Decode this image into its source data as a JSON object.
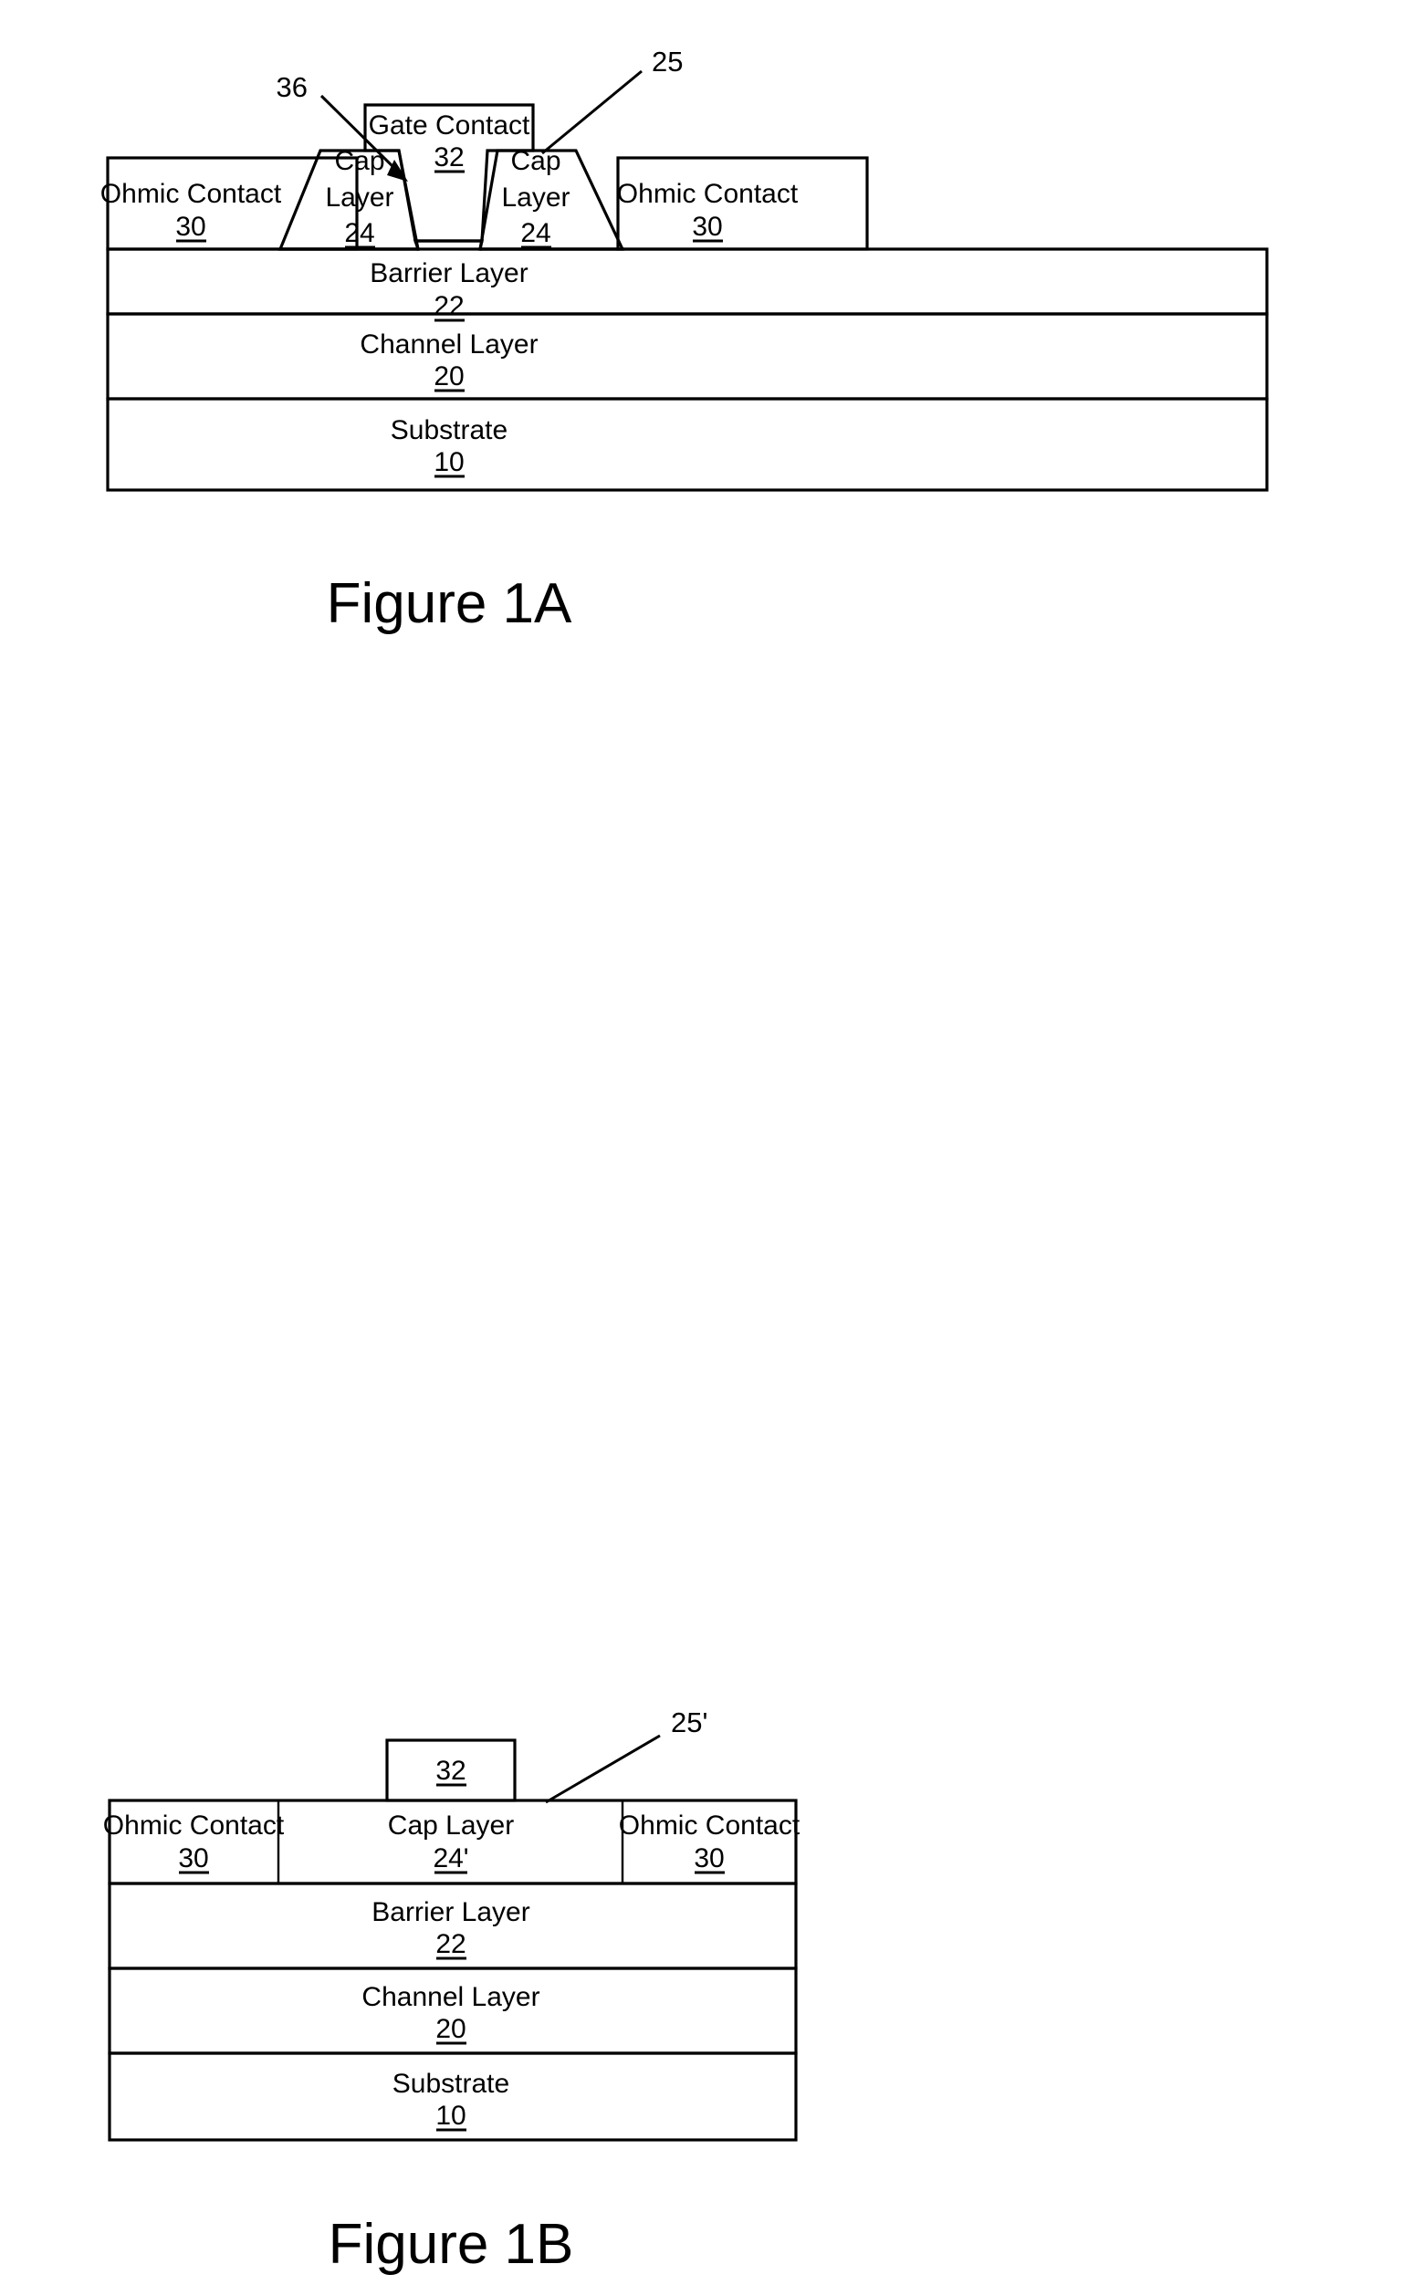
{
  "document": {
    "type": "patent-drawing-sheet",
    "background_color": "#ffffff",
    "line_color": "#000000"
  },
  "figures": [
    {
      "id": "figure-1a",
      "caption": "Figure 1A",
      "layers": [
        {
          "name": "ohmic-contact-left",
          "label": "Ohmic Contact",
          "ref": "30"
        },
        {
          "name": "cap-layer-left",
          "label_line1": "Cap",
          "label_line2": "Layer",
          "ref": "24"
        },
        {
          "name": "gate-contact",
          "label": "Gate Contact",
          "ref": "32"
        },
        {
          "name": "cap-layer-right",
          "label_line1": "Cap",
          "label_line2": "Layer",
          "ref": "24"
        },
        {
          "name": "ohmic-contact-right",
          "label": "Ohmic Contact",
          "ref": "30"
        },
        {
          "name": "barrier-layer",
          "label": "Barrier Layer",
          "ref": "22"
        },
        {
          "name": "channel-layer",
          "label": "Channel Layer",
          "ref": "20"
        },
        {
          "name": "substrate",
          "label": "Substrate",
          "ref": "10"
        }
      ],
      "leaders": [
        {
          "name": "leader-36",
          "ref": "36",
          "style": "arrow"
        },
        {
          "name": "leader-25",
          "ref": "25",
          "style": "plain"
        }
      ]
    },
    {
      "id": "figure-1b",
      "caption": "Figure 1B",
      "layers": [
        {
          "name": "gate-contact",
          "label": "",
          "ref": "32"
        },
        {
          "name": "ohmic-contact-left",
          "label": "Ohmic Contact",
          "ref": "30"
        },
        {
          "name": "cap-layer",
          "label": "Cap Layer",
          "ref": "24'"
        },
        {
          "name": "ohmic-contact-right",
          "label": "Ohmic Contact",
          "ref": "30"
        },
        {
          "name": "barrier-layer",
          "label": "Barrier Layer",
          "ref": "22"
        },
        {
          "name": "channel-layer",
          "label": "Channel Layer",
          "ref": "20"
        },
        {
          "name": "substrate",
          "label": "Substrate",
          "ref": "10"
        }
      ],
      "leaders": [
        {
          "name": "leader-25-prime",
          "ref": "25'",
          "style": "plain"
        }
      ]
    }
  ],
  "fig1a": {
    "caption": "Figure 1A",
    "ref_36": "36",
    "ref_25": "25",
    "gate_contact_label": "Gate Contact",
    "gate_contact_ref": "32",
    "cap_left_line1": "Cap",
    "cap_left_line2": "Layer",
    "cap_left_ref": "24",
    "cap_right_line1": "Cap",
    "cap_right_line2": "Layer",
    "cap_right_ref": "24",
    "ohmic_left_label": "Ohmic Contact",
    "ohmic_left_ref": "30",
    "ohmic_right_label": "Ohmic Contact",
    "ohmic_right_ref": "30",
    "barrier_label": "Barrier Layer",
    "barrier_ref": "22",
    "channel_label": "Channel Layer",
    "channel_ref": "20",
    "substrate_label": "Substrate",
    "substrate_ref": "10"
  },
  "fig1b": {
    "caption": "Figure 1B",
    "ref_25_prime": "25'",
    "gate_contact_ref": "32",
    "ohmic_left_label": "Ohmic Contact",
    "ohmic_left_ref": "30",
    "cap_label": "Cap Layer",
    "cap_ref": "24'",
    "ohmic_right_label": "Ohmic Contact",
    "ohmic_right_ref": "30",
    "barrier_label": "Barrier Layer",
    "barrier_ref": "22",
    "channel_label": "Channel Layer",
    "channel_ref": "20",
    "substrate_label": "Substrate",
    "substrate_ref": "10"
  }
}
